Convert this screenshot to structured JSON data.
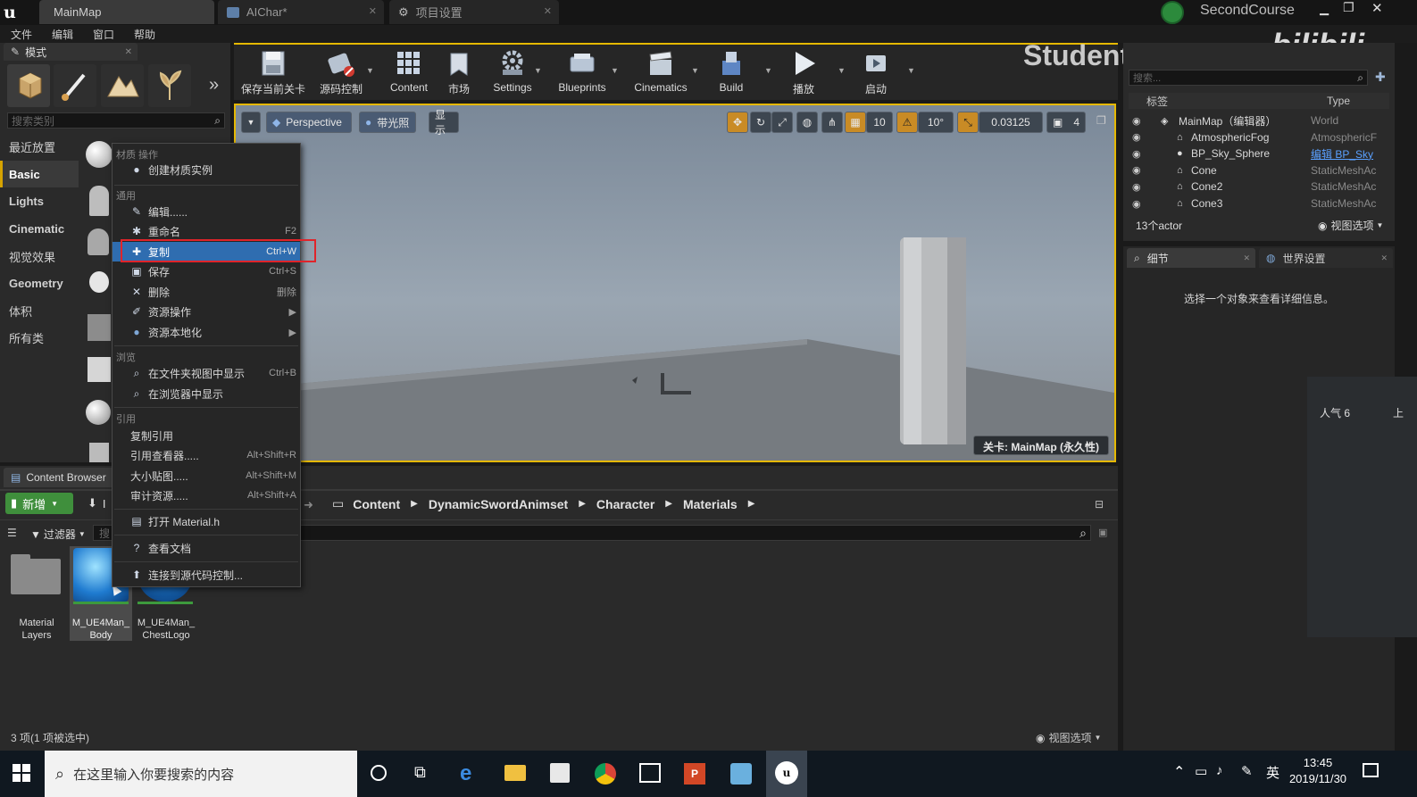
{
  "titlebar": {
    "tabs": [
      {
        "label": "MainMap"
      },
      {
        "label": "AIChar*"
      },
      {
        "label": "项目设置"
      }
    ],
    "user": "SecondCourse",
    "watermark_channel": "StudentLittleRed",
    "watermark_logo": "bilibili"
  },
  "menu": {
    "items": [
      "文件",
      "编辑",
      "窗口",
      "帮助"
    ]
  },
  "modes": {
    "tab_label": "模式",
    "search_placeholder": "搜索类别",
    "categories": [
      "最近放置",
      "Basic",
      "Lights",
      "Cinematic",
      "视觉效果",
      "Geometry",
      "体积",
      "所有类"
    ],
    "active_index": 1
  },
  "toolbar": {
    "buttons": [
      "保存当前关卡",
      "源码控制",
      "Content",
      "市场",
      "Settings",
      "Blueprints",
      "Cinematics",
      "Build",
      "播放",
      "启动"
    ]
  },
  "viewport": {
    "perspective": "Perspective",
    "lit": "带光照",
    "show": "显示",
    "grid_snap": "10",
    "rot_snap": "10°",
    "scale_snap": "0.03125",
    "cam_speed": "4",
    "level_label": "关卡: MainMap (永久性)"
  },
  "outliner": {
    "search_placeholder": "搜索...",
    "col_label": "标签",
    "col_type": "Type",
    "rows": [
      {
        "label": "MainMap（编辑器）",
        "type": "World"
      },
      {
        "label": "AtmosphericFog",
        "type": "AtmosphericF"
      },
      {
        "label": "BP_Sky_Sphere",
        "type": "编辑 BP_Sky"
      },
      {
        "label": "Cone",
        "type": "StaticMeshAc"
      },
      {
        "label": "Cone2",
        "type": "StaticMeshAc"
      },
      {
        "label": "Cone3",
        "type": "StaticMeshAc"
      }
    ],
    "count": "13个actor",
    "view_options": "视图选项"
  },
  "details": {
    "tab_details": "细节",
    "tab_world": "世界设置",
    "empty_msg": "选择一个对象来查看详细信息。",
    "popularity": "人气 6",
    "popularity_side": "上"
  },
  "context_menu": {
    "section_material": "材质 操作",
    "create_instance": "创建材质实例",
    "section_common": "通用",
    "items_common": [
      {
        "label": "编辑......",
        "shortcut": ""
      },
      {
        "label": "重命名",
        "shortcut": "F2"
      },
      {
        "label": "复制",
        "shortcut": "Ctrl+W"
      },
      {
        "label": "保存",
        "shortcut": "Ctrl+S"
      },
      {
        "label": "删除",
        "shortcut": "删除"
      },
      {
        "label": "资源操作",
        "shortcut": ""
      },
      {
        "label": "资源本地化",
        "shortcut": ""
      }
    ],
    "section_browse": "浏览",
    "items_browse": [
      {
        "label": "在文件夹视图中显示",
        "shortcut": "Ctrl+B"
      },
      {
        "label": "在浏览器中显示",
        "shortcut": ""
      }
    ],
    "section_ref": "引用",
    "items_ref": [
      {
        "label": "复制引用",
        "shortcut": ""
      },
      {
        "label": "引用查看器.....",
        "shortcut": "Alt+Shift+R"
      },
      {
        "label": "大小贴图.....",
        "shortcut": "Alt+Shift+M"
      },
      {
        "label": "审计资源.....",
        "shortcut": "Alt+Shift+A"
      }
    ],
    "open_header": "打开 Material.h",
    "view_docs": "查看文档",
    "connect_scc": "连接到源代码控制..."
  },
  "content_browser": {
    "tab_label": "Content Browser",
    "add_new": "新增",
    "import_partial": "I",
    "filters": "过滤器",
    "search_partial": "搜",
    "breadcrumb": [
      "Content",
      "DynamicSwordAnimset",
      "Character",
      "Materials"
    ],
    "assets": [
      {
        "line1": "Material",
        "line2": "Layers"
      },
      {
        "line1": "M_UE4Man_",
        "line2": "Body"
      },
      {
        "line1": "M_UE4Man_",
        "line2": "ChestLogo"
      }
    ],
    "status": "3 项(1 项被选中)",
    "view_options": "视图选项"
  },
  "taskbar": {
    "search_placeholder": "在这里输入你要搜索的内容",
    "ime": "英",
    "time": "13:45",
    "date": "2019/11/30"
  },
  "colors": {
    "accent": "#e5b800",
    "highlight_box": "#e0242a",
    "selection": "#2f6db0"
  }
}
